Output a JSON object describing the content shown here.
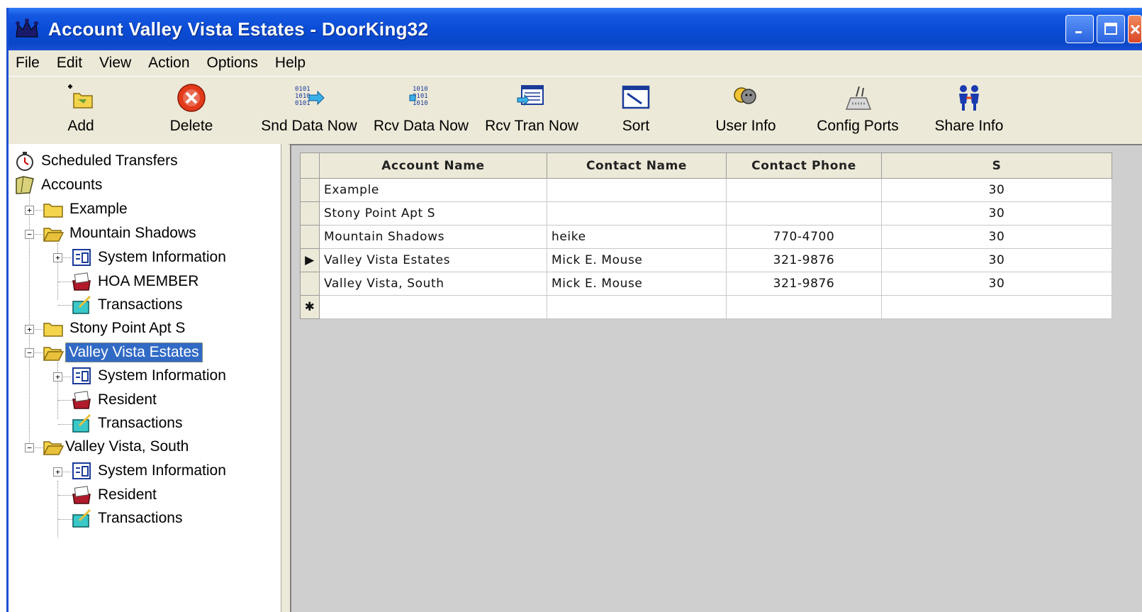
{
  "window": {
    "title": "Account Valley Vista Estates - DoorKing32",
    "app_icon": "crown-icon"
  },
  "menu": [
    "File",
    "Edit",
    "View",
    "Action",
    "Options",
    "Help"
  ],
  "toolbar": [
    {
      "label": "Add",
      "icon": "add-folder-icon"
    },
    {
      "label": "Delete",
      "icon": "delete-icon"
    },
    {
      "label": "Snd Data Now",
      "icon": "send-data-icon"
    },
    {
      "label": "Rcv Data Now",
      "icon": "receive-data-icon"
    },
    {
      "label": "Rcv Tran Now",
      "icon": "receive-transactions-icon"
    },
    {
      "label": "Sort",
      "icon": "sort-icon"
    },
    {
      "label": "User Info",
      "icon": "user-info-icon"
    },
    {
      "label": "Config Ports",
      "icon": "config-ports-icon"
    },
    {
      "label": "Share Info",
      "icon": "share-info-icon"
    }
  ],
  "tree": {
    "scheduled": "Scheduled Transfers",
    "accounts": "Accounts",
    "example": "Example",
    "mountain_shadows": "Mountain Shadows",
    "ms_system": "System Information",
    "ms_hoa": "HOA MEMBER",
    "ms_trans": "Transactions",
    "stony_point": "Stony Point Apt S",
    "vve": "Valley Vista Estates",
    "vve_system": "System Information",
    "vve_resident": "Resident",
    "vve_trans": "Transactions",
    "vvs": "Valley Vista, South",
    "vvs_system": "System Information",
    "vvs_resident": "Resident",
    "vvs_trans": "Transactions"
  },
  "grid": {
    "columns": [
      "Account Name",
      "Contact Name",
      "Contact Phone",
      "S"
    ],
    "rows": [
      {
        "account": "Example",
        "contact": "",
        "phone": "",
        "s": "30",
        "current": false
      },
      {
        "account": "Stony Point Apt S",
        "contact": "",
        "phone": "",
        "s": "30",
        "current": false
      },
      {
        "account": "Mountain Shadows",
        "contact": "heike",
        "phone": "770-4700",
        "s": "30",
        "current": false
      },
      {
        "account": "Valley Vista Estates",
        "contact": "Mick E. Mouse",
        "phone": "321-9876",
        "s": "30",
        "current": true
      },
      {
        "account": "Valley Vista, South",
        "contact": "Mick E. Mouse",
        "phone": "321-9876",
        "s": "30",
        "current": false
      }
    ],
    "current_row_marker": "▶",
    "new_row_marker": "✱"
  }
}
